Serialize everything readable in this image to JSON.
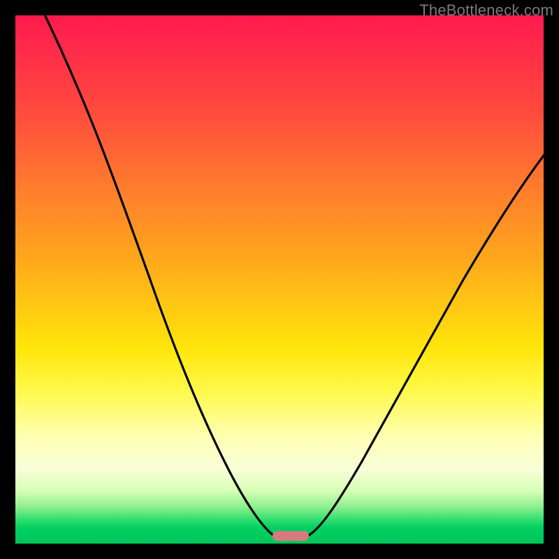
{
  "watermark": "TheBottleneck.com",
  "colors": {
    "frame": "#000000",
    "curve_stroke": "#000000",
    "marker_fill": "#d87a7d",
    "gradient_top": "#ff1a4d",
    "gradient_bottom": "#00c55a"
  },
  "chart_data": {
    "type": "line",
    "title": "",
    "xlabel": "",
    "ylabel": "",
    "xlim": [
      0,
      100
    ],
    "ylim": [
      0,
      100
    ],
    "x": [
      0,
      5,
      10,
      15,
      20,
      25,
      30,
      35,
      40,
      45,
      48,
      50,
      52,
      54,
      56,
      60,
      65,
      70,
      75,
      80,
      85,
      90,
      95,
      100
    ],
    "values": [
      100,
      92,
      84,
      76,
      68,
      60,
      51,
      41,
      30,
      15,
      4,
      0,
      0,
      0,
      2,
      10,
      21,
      31,
      40,
      48,
      55,
      62,
      68,
      74
    ],
    "annotations": [
      {
        "kind": "marker",
        "shape": "pill",
        "x": 52,
        "y": 1,
        "color": "#d87a7d"
      }
    ],
    "notes": "V-shaped bottleneck curve; minimum (0) around x≈50–54. Left branch descends from 100 at x=0; right branch ascends to ≈74 at x=100. No axis ticks or labels are shown."
  }
}
